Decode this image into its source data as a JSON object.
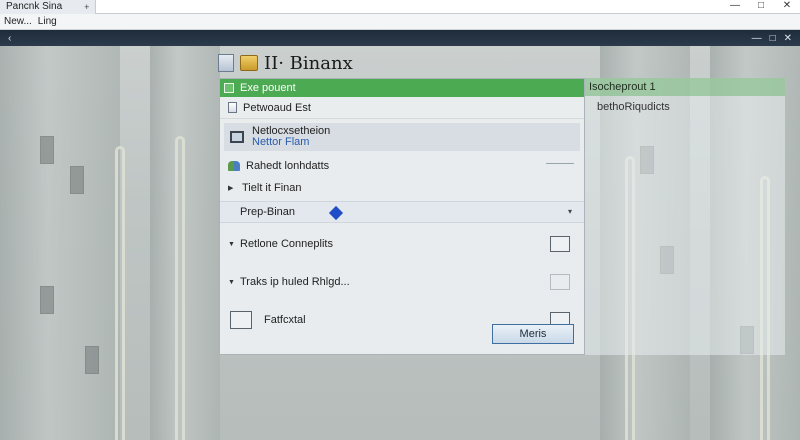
{
  "window": {
    "tab_title": "Pancnk Sina",
    "tab_close": "+",
    "controls": {
      "minimize": "—",
      "maximize": "□",
      "close": "✕"
    }
  },
  "menu": {
    "items": [
      "New...",
      "Ling"
    ]
  },
  "nav": {
    "back": "‹",
    "minimize": "—",
    "maximize": "□",
    "close": "✕"
  },
  "heading": {
    "title": "II· Binanx"
  },
  "dialog": {
    "header": "Exe pouent",
    "sub_label": "Petwoaud Est",
    "panel": {
      "title": "Netlocxsetheion",
      "subtitle": "Nettor Flam"
    },
    "row_contacts": "Rahedt lonhdatts",
    "row_expand": "Tielt it Finan",
    "select": {
      "value": "Prep-Binan",
      "caret": "▾"
    },
    "option1": "Retlone Conneplits",
    "option2": "Traks ip huled Rhlgd...",
    "option3": "Fatfcxtal",
    "ok_label": "Meris"
  },
  "right_panel": {
    "header": "Isocheprout 1",
    "link": "bethoRiqudicts"
  },
  "colors": {
    "accent": "#4caa52",
    "select_marker": "#1f4ec7"
  }
}
